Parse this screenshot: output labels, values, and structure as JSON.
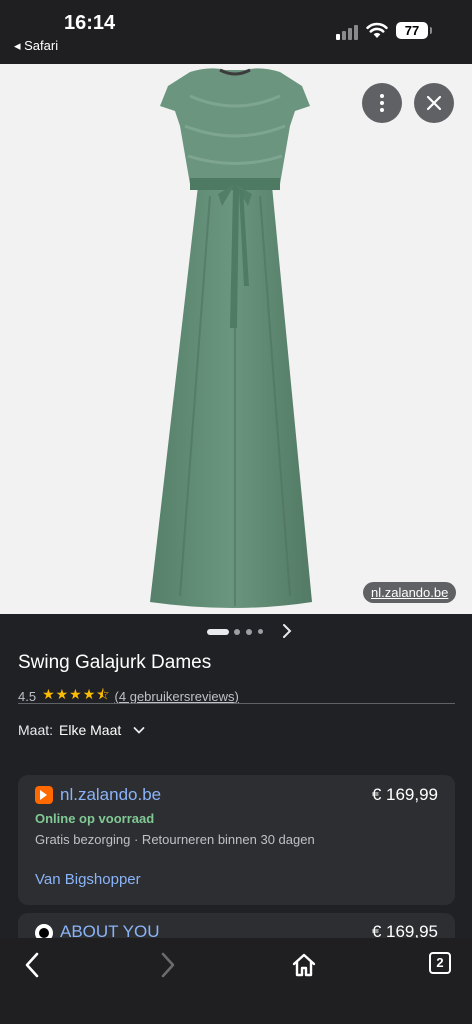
{
  "status_bar": {
    "time": "16:14",
    "back_app": "◂ Safari",
    "battery": "77"
  },
  "image": {
    "source_label": "nl.zalando.be",
    "more_icon": "more-vertical-icon",
    "close_icon": "close-icon"
  },
  "carousel": {
    "total_dots": 4,
    "active_index": 0
  },
  "product": {
    "title": "Swing Galajurk Dames",
    "rating": "4.5",
    "stars_display": "★★★★⯪",
    "reviews": "(4 gebruikersreviews)"
  },
  "size_filter": {
    "label": "Maat:",
    "value": "Elke Maat"
  },
  "offers": [
    {
      "store": "nl.zalando.be",
      "price": "€ 169,99",
      "stock": "Online op voorraad",
      "delivery": "Gratis bezorging · Retourneren binnen 30 dagen",
      "seller": "Van Bigshopper"
    },
    {
      "store": "ABOUT YOU",
      "price": "€ 169,95"
    }
  ],
  "toolbar": {
    "tabs_count": "2"
  },
  "colors": {
    "background": "#202124",
    "link": "#8ab4f8",
    "in_stock": "#81c995",
    "star": "#fbbc04",
    "zalando_brand": "#ff6900",
    "dress": "#5f8a72"
  }
}
